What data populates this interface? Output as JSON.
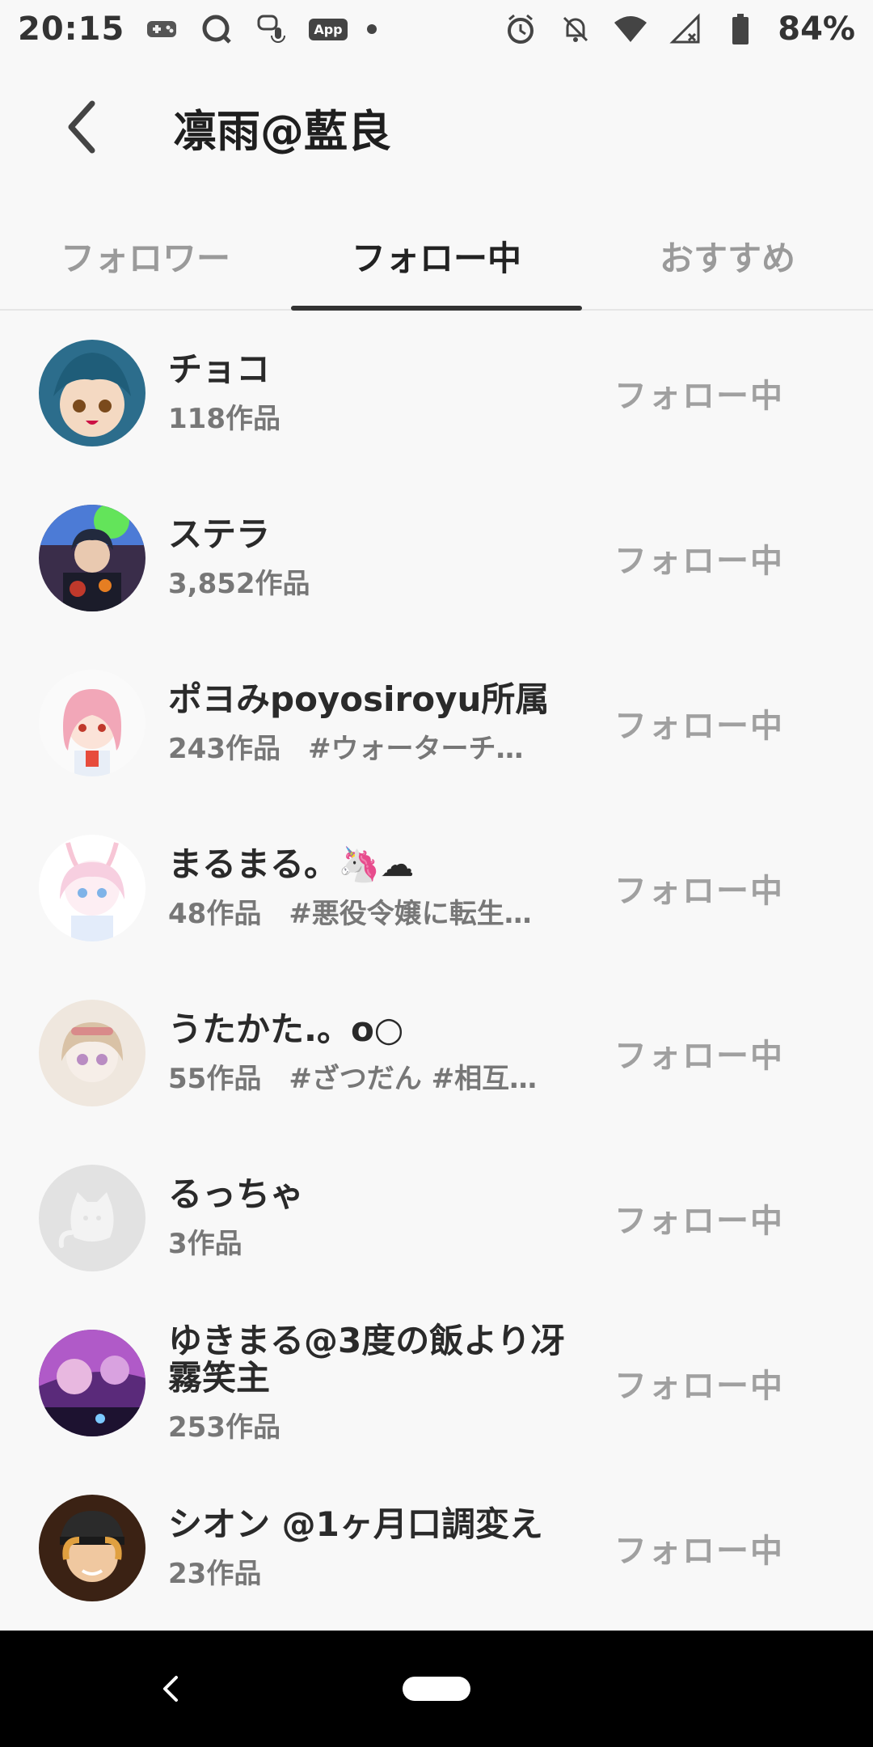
{
  "status_bar": {
    "time": "20:15",
    "battery": "84%",
    "app_badge": "App",
    "icons_left": [
      "gamepad-icon",
      "chat-bubble-icon",
      "voice-message-icon",
      "app-badge-icon",
      "dot-icon"
    ],
    "icons_right": [
      "alarm-icon",
      "notifications-off-icon",
      "wifi-icon",
      "signal-icon",
      "battery-icon"
    ]
  },
  "header": {
    "title": "凛雨@藍良",
    "back_icon": "chevron-left-icon"
  },
  "tabs": [
    {
      "label": "フォロワー",
      "active": false
    },
    {
      "label": "フォロー中",
      "active": true
    },
    {
      "label": "おすすめ",
      "active": false
    }
  ],
  "users": [
    {
      "name": "チョコ",
      "sub": "118作品",
      "button": "フォロー中",
      "avatar": "avatar-blue-hair"
    },
    {
      "name": "ステラ",
      "sub": "3,852作品",
      "button": "フォロー中",
      "avatar": "avatar-dark-hair"
    },
    {
      "name": "ポヨみpoyosiroyu所属",
      "sub": "243作品　#ウォーターチ…",
      "button": "フォロー中",
      "avatar": "avatar-pink-hair"
    },
    {
      "name": "まるまる。🦄☁",
      "sub": "48作品　#悪役令嬢に転生…",
      "button": "フォロー中",
      "avatar": "avatar-pastel"
    },
    {
      "name": "うたかた.。o○",
      "sub": "55作品　#ざつだん #相互…",
      "button": "フォロー中",
      "avatar": "avatar-sketch"
    },
    {
      "name": "るっちゃ",
      "sub": "3作品",
      "button": "フォロー中",
      "avatar": "avatar-default-cat"
    },
    {
      "name": "ゆきまる@3度の飯より冴霧笑主",
      "sub": "253作品",
      "button": "フォロー中",
      "avatar": "avatar-purple"
    },
    {
      "name": "シオン @1ヶ月口調変え",
      "sub": "23作品",
      "button": "フォロー中",
      "avatar": "avatar-orange-hair"
    }
  ],
  "nav": {
    "back_icon": "nav-back-icon",
    "home_icon": "home-pill-icon"
  },
  "colors": {
    "background": "#f8f8f8",
    "tab_active": "#222222",
    "tab_inactive": "#9a9a9a",
    "follow_button_text": "#a0a0a0"
  }
}
